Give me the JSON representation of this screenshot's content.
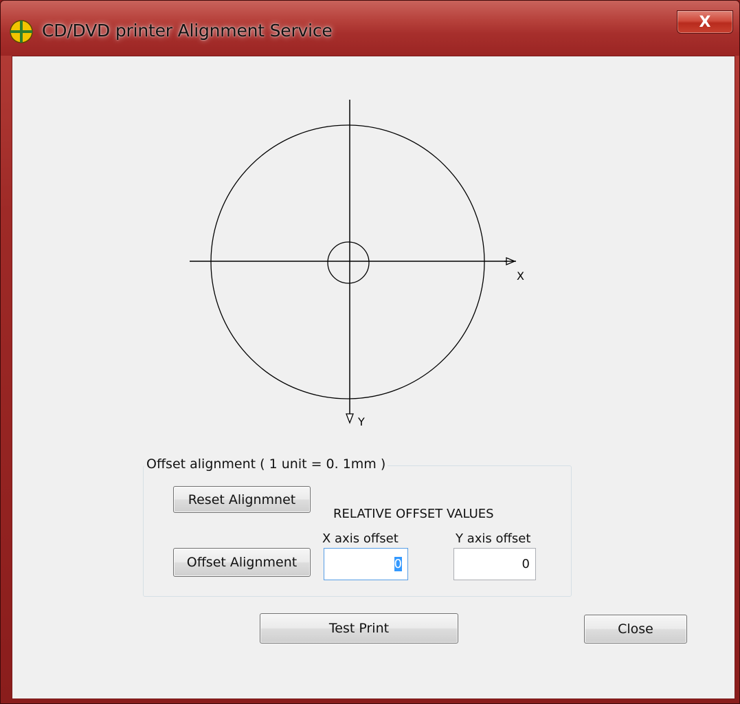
{
  "window": {
    "title": "CD/DVD printer Alignment Service",
    "close_glyph": "X",
    "icon": "alignment-target-icon"
  },
  "diagram": {
    "x_label": "X",
    "y_label": "Y"
  },
  "offset_group": {
    "legend": "Offset alignment ( 1 unit = 0. 1mm )",
    "reset_label": "Reset Alignmnet",
    "offset_label": "Offset Alignment",
    "relative_heading": "RELATIVE OFFSET VALUES",
    "x_axis_label": "X axis offset",
    "y_axis_label": "Y axis offset",
    "x_value": "0",
    "y_value": "0"
  },
  "footer": {
    "test_print_label": "Test Print",
    "close_label": "Close"
  },
  "colors": {
    "title_bar": "#a72f2c",
    "close_button": "#cf4a3b",
    "client_background": "#f0f0f0",
    "selection": "#3399ff"
  }
}
